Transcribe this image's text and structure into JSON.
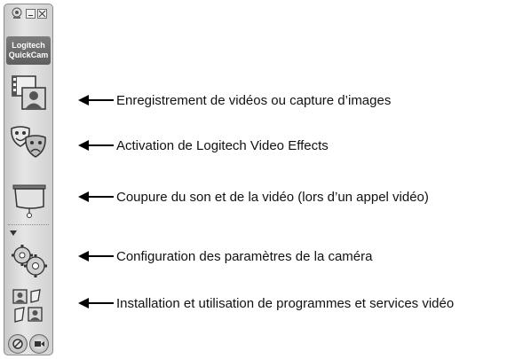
{
  "app": {
    "brand_line1": "Logitech",
    "brand_line2": "QuickCam"
  },
  "toolbar": {
    "tools": [
      {
        "icon": "film-photo-capture-icon"
      },
      {
        "icon": "theater-masks-icon"
      },
      {
        "icon": "privacy-shade-icon"
      },
      {
        "icon": "gears-settings-icon"
      },
      {
        "icon": "video-programs-icon"
      }
    ],
    "bottom_buttons": [
      {
        "icon": "help-icon"
      },
      {
        "icon": "video-call-icon"
      }
    ]
  },
  "callouts": [
    {
      "text": "Enregistrement de vidéos ou capture d’images"
    },
    {
      "text": "Activation de Logitech Video Effects"
    },
    {
      "text": "Coupure du son et de la vidéo (lors d’un appel vidéo)"
    },
    {
      "text": "Configuration des paramètres de la caméra"
    },
    {
      "text": "Installation et utilisation de programmes et services vidéo"
    }
  ]
}
